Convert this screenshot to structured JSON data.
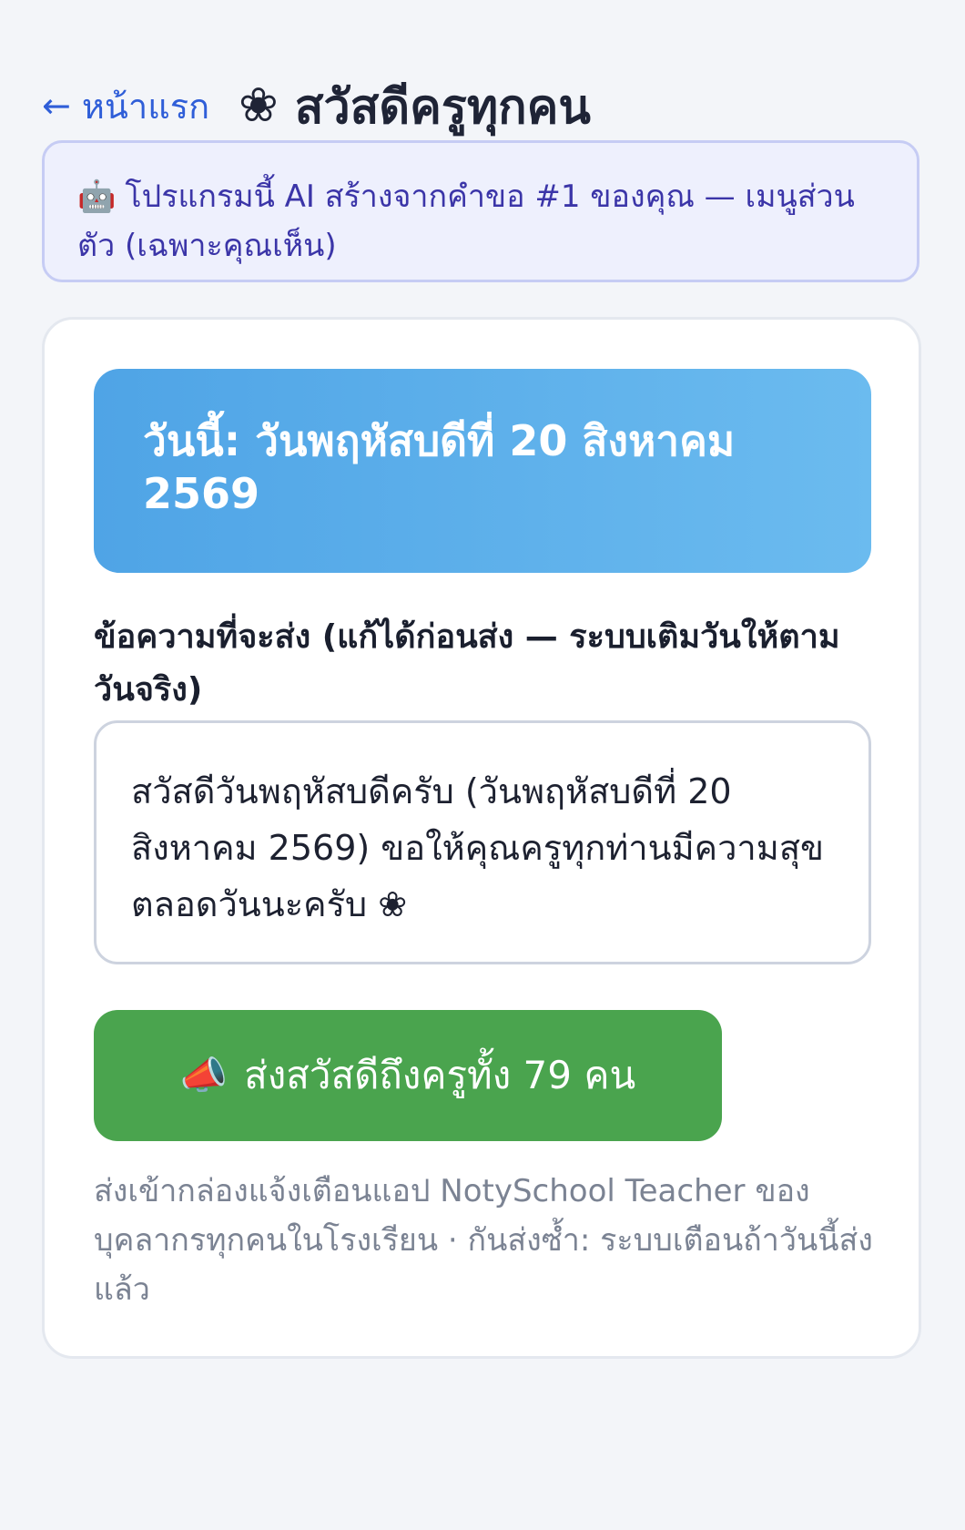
{
  "header": {
    "back_arrow": "←",
    "back_label": "หน้าแรก",
    "title_icon": "❀",
    "title": "สวัสดีครูทุกคน"
  },
  "ai_banner": {
    "icon": "🤖",
    "text": "โปรแกรมนี้ AI สร้างจากคำขอ #1 ของคุณ — เมนูส่วนตัว (เฉพาะคุณเห็น)"
  },
  "date_banner": {
    "text": "วันนี้: วันพฤหัสบดีที่ 20 สิงหาคม 2569"
  },
  "message": {
    "label": "ข้อความที่จะส่ง (แก้ได้ก่อนส่ง — ระบบเติมวันให้ตามวันจริง)",
    "value": "สวัสดีวันพฤหัสบดีครับ (วันพฤหัสบดีที่ 20 สิงหาคม 2569) ขอให้คุณครูทุกท่านมีความสุขตลอดวันนะครับ ❀"
  },
  "send_button": {
    "icon": "📣",
    "label": "ส่งสวัสดีถึงครูทั้ง 79 คน"
  },
  "note": {
    "text": "ส่งเข้ากล่องแจ้งเตือนแอป NotySchool Teacher ของบุคลากรทุกคนในโรงเรียน · กันส่งซ้ำ: ระบบเตือนถ้าวันนี้ส่งแล้ว"
  },
  "colors": {
    "background": "#f3f5f9",
    "accent_link": "#2f5ed8",
    "ai_banner_bg": "#eef0fd",
    "ai_banner_text": "#3b35a8",
    "date_banner_bg": "#5aaee9",
    "send_button_bg": "#4aa44e",
    "note_text": "#7b8393"
  },
  "icons": {
    "back": "arrow-left-icon",
    "title": "flower-icon",
    "ai": "robot-icon",
    "send": "megaphone-icon"
  }
}
